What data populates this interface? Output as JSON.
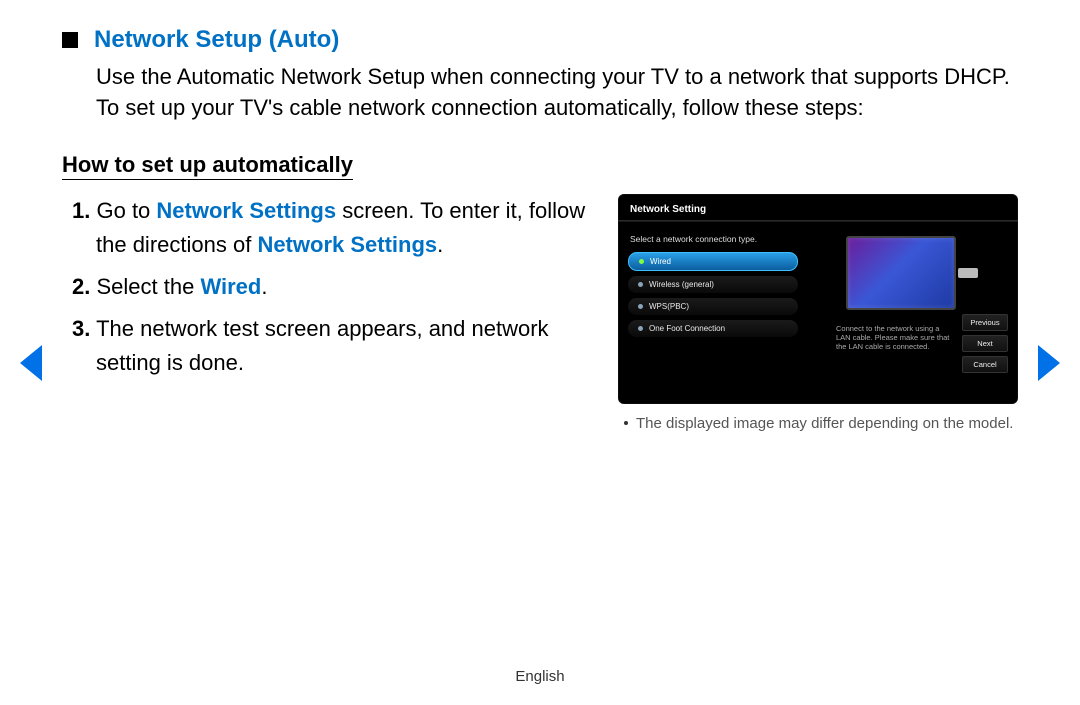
{
  "section": {
    "title": "Network Setup (Auto)",
    "intro": "Use the Automatic Network Setup when connecting your TV to a network that supports DHCP. To set up your TV's cable network connection automatically, follow these steps:",
    "subheading": "How to set up automatically"
  },
  "steps": {
    "s1_num": "1.",
    "s1_a": "Go to ",
    "s1_link1": "Network Settings",
    "s1_b": " screen. To enter it, follow the directions of ",
    "s1_link2": "Network Settings",
    "s1_c": ".",
    "s2_num": "2.",
    "s2_a": "Select the ",
    "s2_link": "Wired",
    "s2_b": ".",
    "s3_num": "3.",
    "s3_text": "The network test screen appears, and network setting is done."
  },
  "tv": {
    "title": "Network Setting",
    "instruction": "Select a network connection type.",
    "options": [
      {
        "label": "Wired",
        "selected": true
      },
      {
        "label": "Wireless (general)",
        "selected": false
      },
      {
        "label": "WPS(PBC)",
        "selected": false
      },
      {
        "label": "One Foot Connection",
        "selected": false
      }
    ],
    "desc": "Connect to the network using a LAN cable. Please make sure that the LAN cable is connected.",
    "buttons": {
      "prev": "Previous",
      "next": "Next",
      "cancel": "Cancel"
    }
  },
  "caption": "The displayed image may differ depending on the model.",
  "footer": "English"
}
